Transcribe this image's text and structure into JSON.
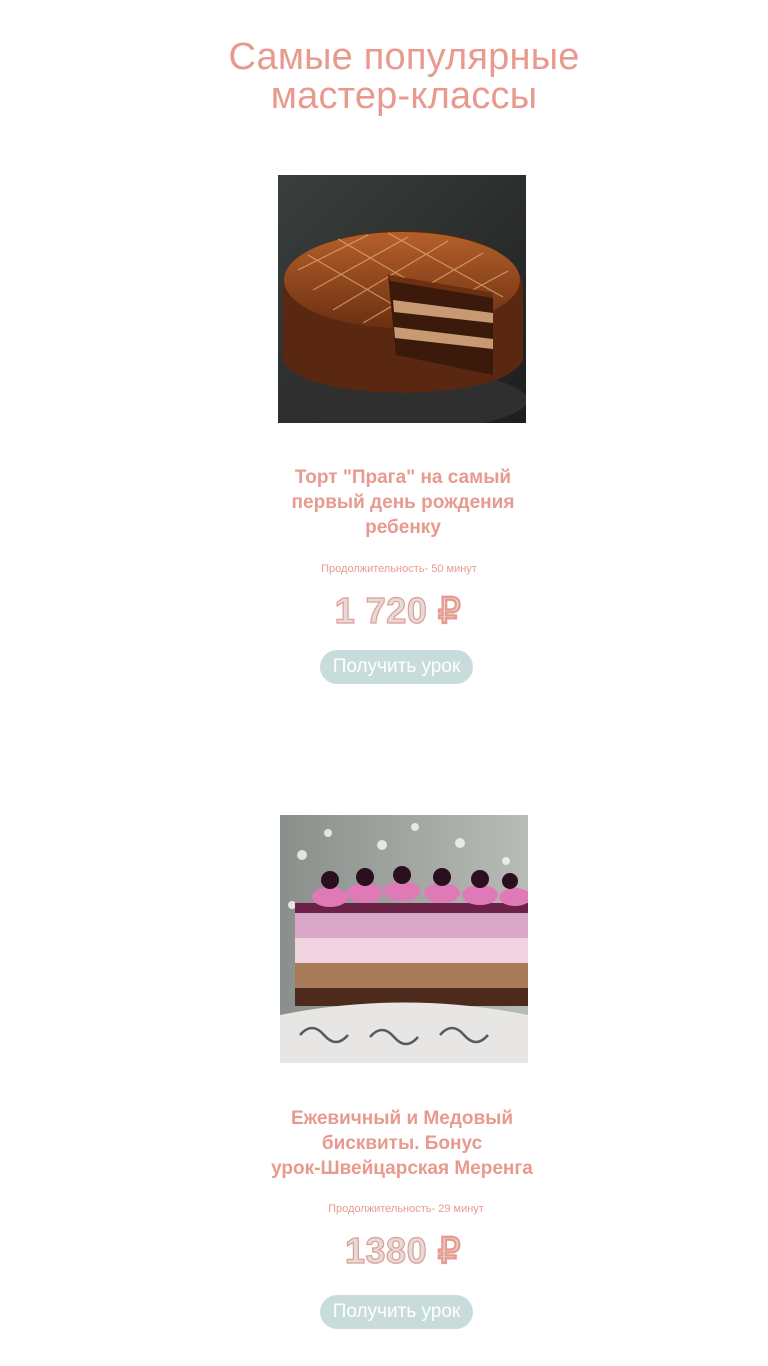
{
  "header": {
    "title_line1": "Самые популярные",
    "title_line2": "мастер-классы"
  },
  "courses": [
    {
      "image_alt": "Торт «Прага» с нарезанным куском",
      "title_line1": "Торт \"Прага\" на самый",
      "title_line2": "первый день рождения",
      "title_line3": "ребенку",
      "duration": "Продолжительность- 50 минут",
      "price": "1 720 ₽",
      "button_label": "Получить урок"
    },
    {
      "image_alt": "Ежевичный и медовый бисквит на подставке",
      "title_line1": "Ежевичный и Медовый",
      "title_line2": "бисквиты. Бонус",
      "title_line3": "урок-Швейцарская Меренга",
      "duration": "Продолжительность-  29 минут",
      "price": "1380 ₽",
      "button_label": "Получить урок"
    }
  ],
  "colors": {
    "accent": "#e89a8f",
    "button_bg": "#c9dcdc",
    "button_text": "#ffffff",
    "price_fill": "#dddddd"
  }
}
